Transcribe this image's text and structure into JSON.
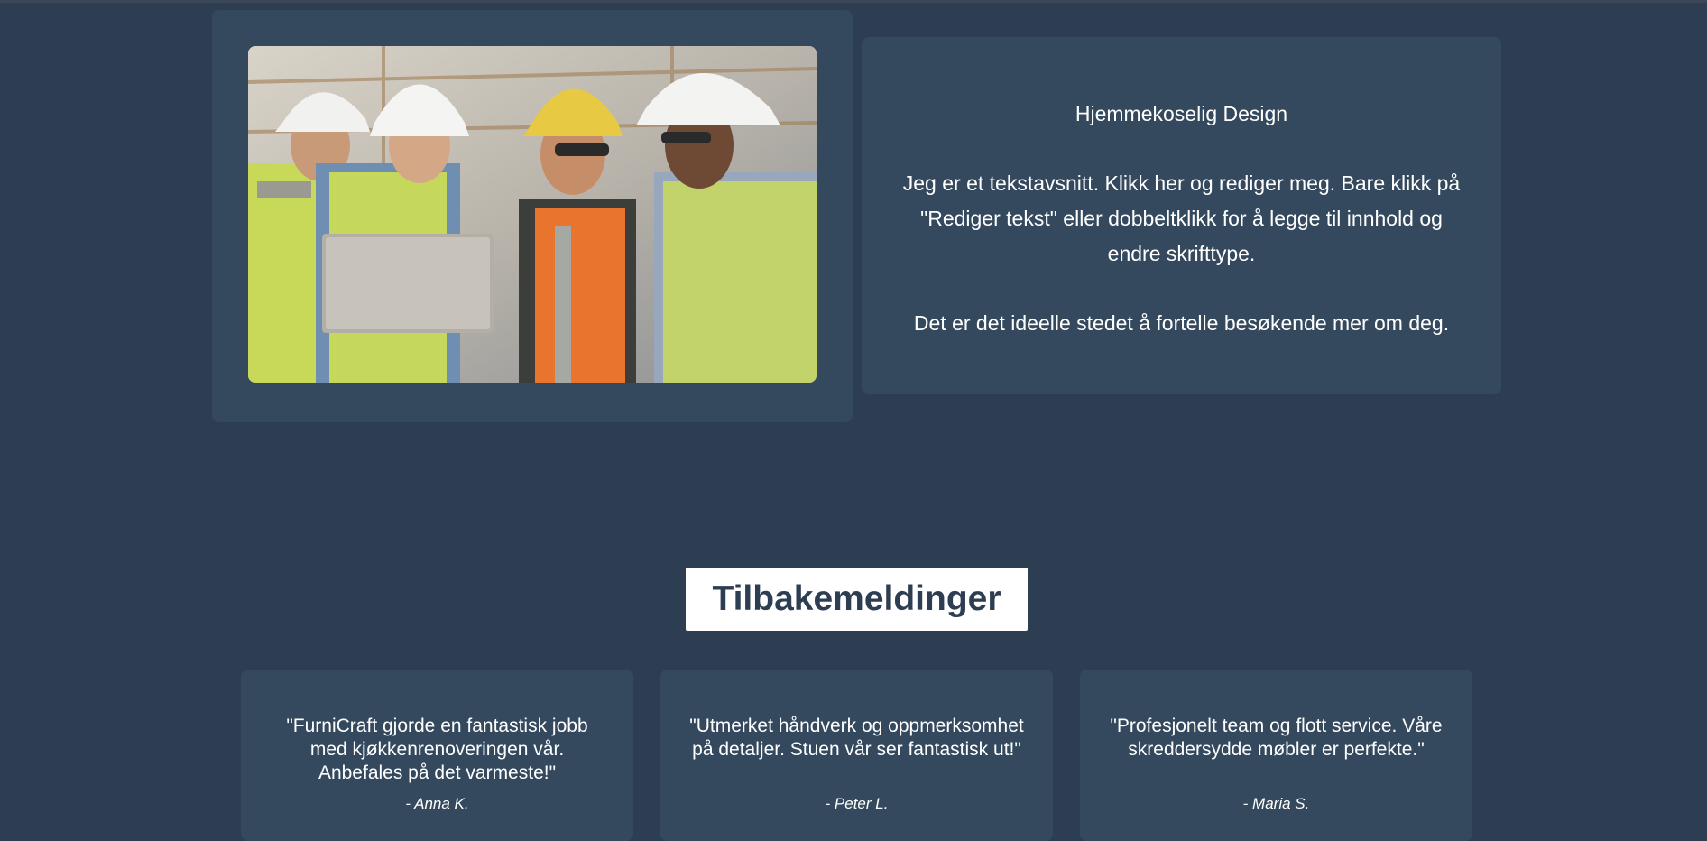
{
  "about": {
    "image_alt": "Anleggsarbeidere med hjelm og refleksvest ser på en bærbar PC",
    "heading": "Hjemmekoselig Design",
    "paragraph1": "Jeg er et tekstavsnitt. Klikk her og rediger meg. Bare klikk på \"Rediger tekst\" eller dobbeltklikk for å legge til innhold og endre skrifttype.",
    "paragraph2": "Det er det ideelle stedet å fortelle besøkende mer om deg."
  },
  "testimonials": {
    "title": "Tilbakemeldinger",
    "items": [
      {
        "quote": "\"FurniCraft gjorde en fantastisk jobb med kjøkkenrenoveringen vår. Anbefales på det varmeste!\"",
        "author": "- Anna K."
      },
      {
        "quote": "\"Utmerket håndverk og oppmerksomhet på detaljer. Stuen vår ser fantastisk ut!\"",
        "author": "- Peter L."
      },
      {
        "quote": "\"Profesjonelt team og flott service. Våre skreddersydde møbler er perfekte.\"",
        "author": "- Maria S."
      }
    ]
  },
  "colors": {
    "background": "#2d3d52",
    "card": "#34495e",
    "title_box": "#ffffff",
    "title_text": "#2d3d52"
  }
}
